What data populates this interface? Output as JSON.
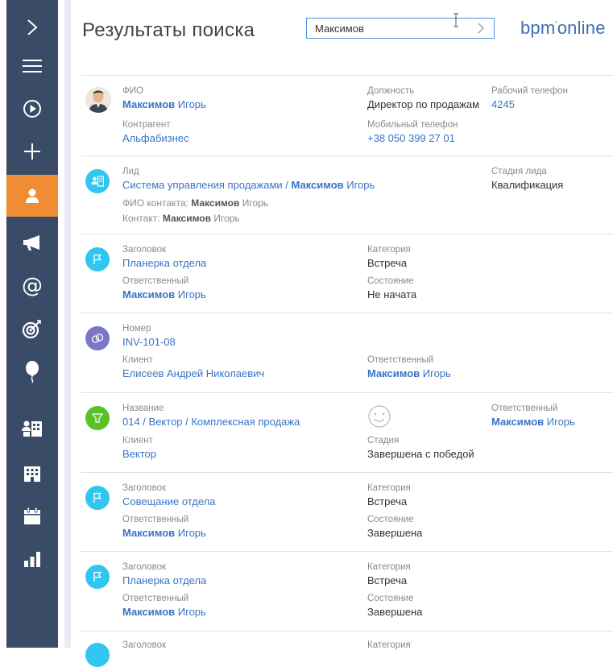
{
  "header": {
    "title": "Результаты поиска",
    "search_value": "Максимов",
    "logo": "bpm",
    "logo_sup": "'",
    "logo_rest": "online"
  },
  "sidebar": {
    "items": [
      {
        "icon": "chevron-right-icon"
      },
      {
        "icon": "menu-icon"
      },
      {
        "icon": "play-icon"
      },
      {
        "icon": "plus-icon"
      },
      {
        "icon": "contact-icon",
        "active": true
      },
      {
        "icon": "megaphone-icon"
      },
      {
        "icon": "email-icon"
      },
      {
        "icon": "target-icon"
      },
      {
        "icon": "balloon-icon"
      },
      {
        "icon": "accounts-icon"
      },
      {
        "icon": "building-icon"
      },
      {
        "icon": "calendar-icon"
      },
      {
        "icon": "dashboard-icon"
      }
    ],
    "active_color": "#f08d34",
    "bg_color": "#394b66"
  },
  "results": {
    "r1": {
      "l1": "ФИО",
      "v1a": "Максимов",
      "v1b": " Игорь",
      "l2": "Должность",
      "v2": "Директор по продажам",
      "l3": "Рабочий телефон",
      "v3": "4245",
      "l4": "Контрагент",
      "v4": "Альфабизнес",
      "l5": "Мобильный телефон",
      "v5": "+38 050 399 27 01"
    },
    "r2": {
      "l1": "Лид",
      "v1a": "Система управления продажами / ",
      "v1b": "Максимов",
      "v1c": " Игорь",
      "l2": "Стадия лида",
      "v2": "Квалификация",
      "s1a": "ФИО контакта: ",
      "s1b": "Максимов",
      "s1c": " Игорь",
      "s2a": "Контакт: ",
      "s2b": "Максимов",
      "s2c": " Игорь"
    },
    "r3": {
      "l1": "Заголовок",
      "v1": "Планерка отдела",
      "l2": "Категория",
      "v2": "Встреча",
      "l3": "Ответственный",
      "v3a": "Максимов",
      "v3b": " Игорь",
      "l4": "Состояние",
      "v4": "Не начата"
    },
    "r4": {
      "l1": "Номер",
      "v1": "INV-101-08",
      "l2": "Клиент",
      "v2": "Елисеев Андрей Николаевич",
      "l3": "Ответственный",
      "v3a": "Максимов",
      "v3b": " Игорь"
    },
    "r5": {
      "l1": "Название",
      "v1": "014 / Вектор / Комплексная продажа",
      "l2": "Ответственный",
      "v2a": "Максимов",
      "v2b": " Игорь",
      "l3": "Клиент",
      "v3": "Вектор",
      "l4": "Стадия",
      "v4": "Завершена с победой"
    },
    "r6": {
      "l1": "Заголовок",
      "v1": "Совещание отдела",
      "l2": "Категория",
      "v2": "Встреча",
      "l3": "Ответственный",
      "v3a": "Максимов",
      "v3b": " Игорь",
      "l4": "Состояние",
      "v4": "Завершена"
    },
    "r7": {
      "l1": "Заголовок",
      "v1": "Планерка отдела",
      "l2": "Категория",
      "v2": "Встреча",
      "l3": "Ответственный",
      "v3a": "Максимов",
      "v3b": " Игорь",
      "l4": "Состояние",
      "v4": "Завершена"
    },
    "r8": {
      "l1": "Заголовок",
      "l2": "Категория"
    }
  },
  "colors": {
    "link": "#3874c4",
    "activity_icon": "#31c6f0",
    "lead_icon": "#31c6f0",
    "invoice_icon": "#7b76c9",
    "opportunity_icon": "#58c226"
  }
}
